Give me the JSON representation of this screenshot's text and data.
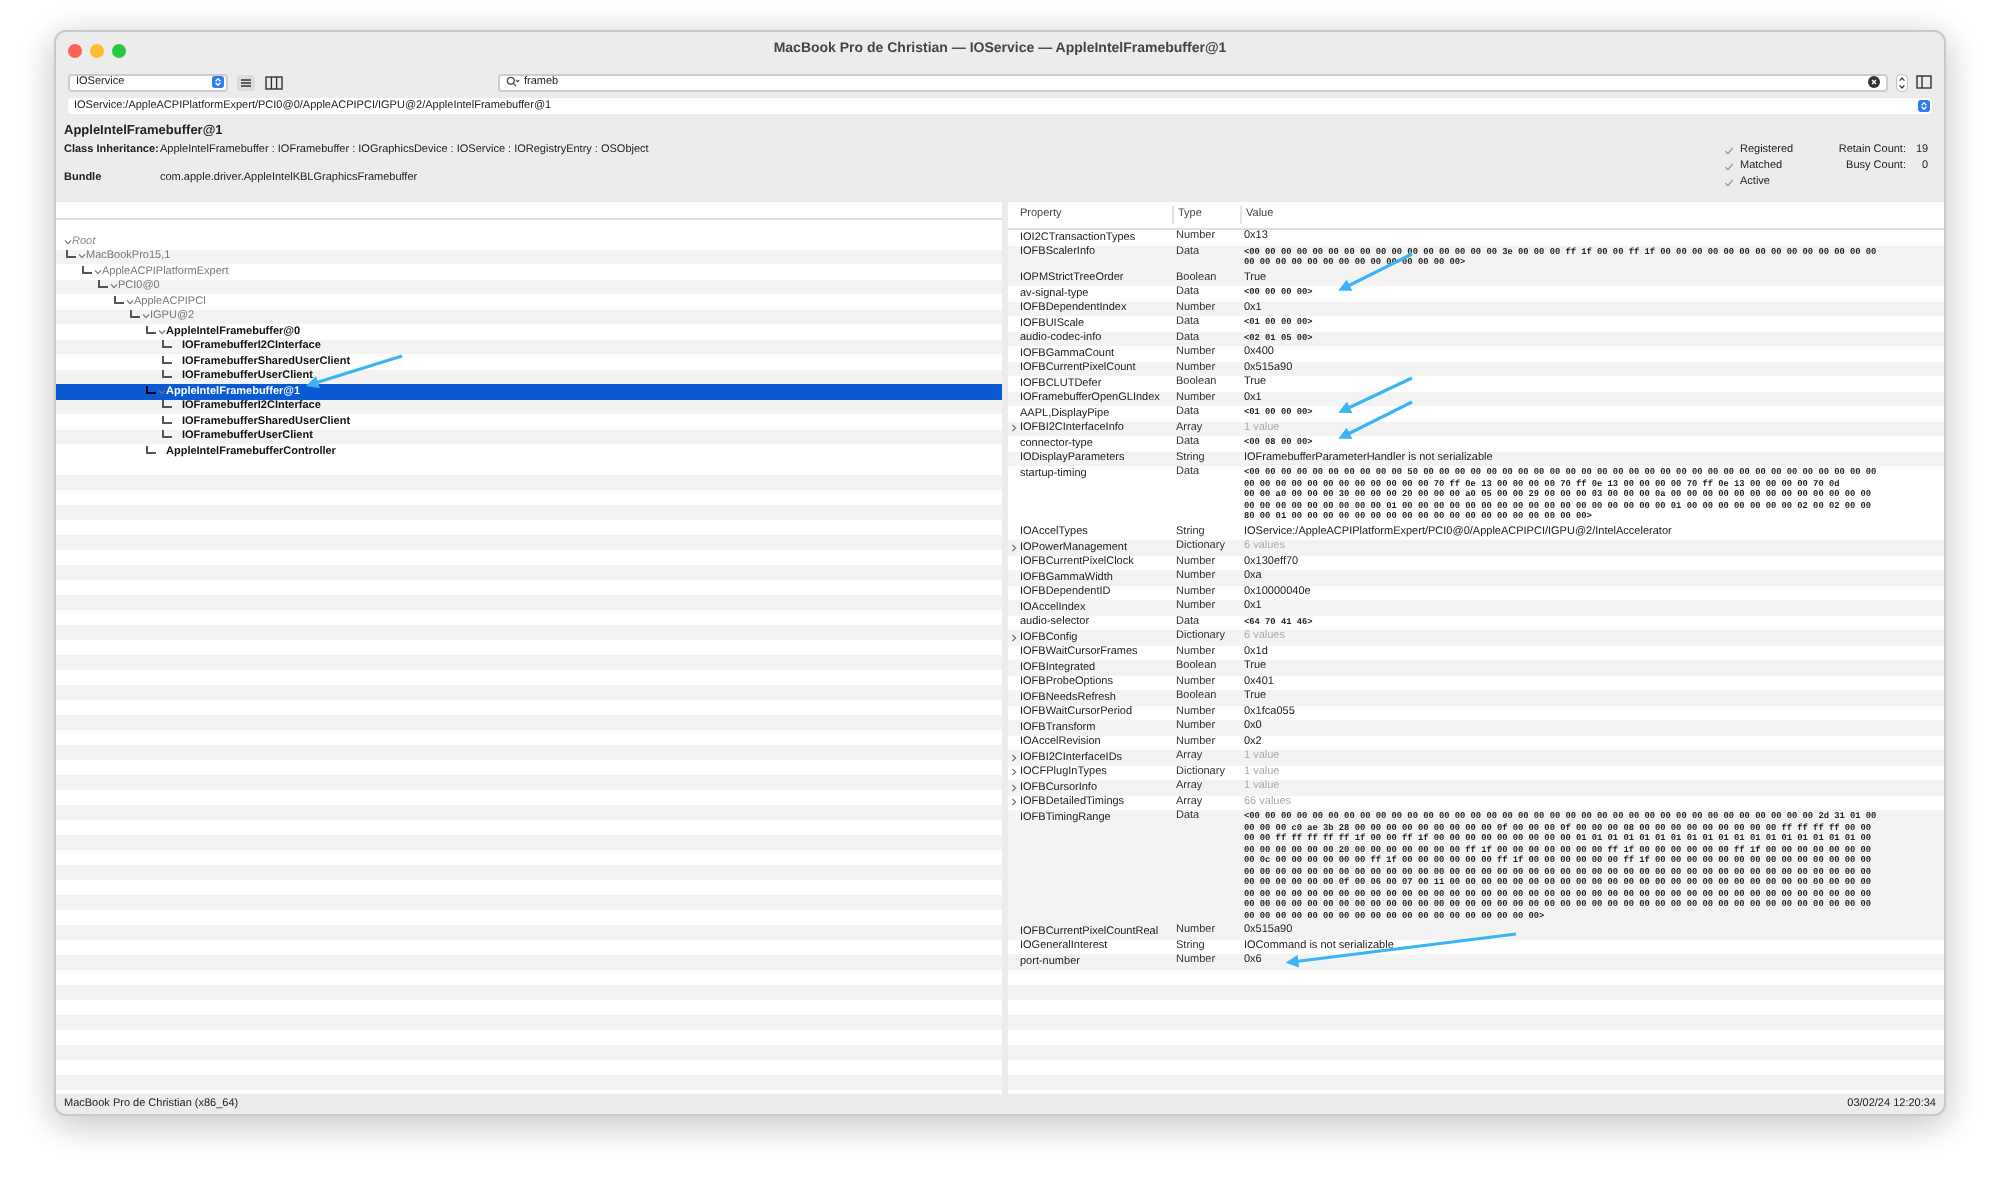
{
  "window": {
    "title": "MacBook Pro de Christian — IOService — AppleIntelFramebuffer@1"
  },
  "toolbar": {
    "plane": "IOService",
    "search": {
      "value": "frameb"
    }
  },
  "path": "IOService:/AppleACPIPlatformExpert/PCI0@0/AppleACPIPCI/IGPU@2/AppleIntelFramebuffer@1",
  "header": {
    "title": "AppleIntelFramebuffer@1",
    "inheritance_label": "Class Inheritance:",
    "inheritance": "AppleIntelFramebuffer : IOFramebuffer : IOGraphicsDevice : IOService : IORegistryEntry : OSObject",
    "bundle_label": "Bundle",
    "bundle": "com.apple.driver.AppleIntelKBLGraphicsFramebuffer",
    "flags": [
      {
        "label": "Registered",
        "checked": true
      },
      {
        "label": "Matched",
        "checked": true
      },
      {
        "label": "Active",
        "checked": true
      }
    ],
    "counts": [
      {
        "label": "Retain Count:",
        "value": "19"
      },
      {
        "label": "Busy Count:",
        "value": "0"
      }
    ]
  },
  "tree": [
    {
      "label": "Root",
      "kind": "root",
      "expanded": true,
      "selected": false,
      "children": [
        {
          "label": "MacBookPro15,1",
          "kind": "nub",
          "expanded": true,
          "selected": false,
          "children": [
            {
              "label": "AppleACPIPlatformExpert",
              "kind": "nub",
              "expanded": true,
              "selected": false,
              "children": [
                {
                  "label": "PCI0@0",
                  "kind": "nub",
                  "expanded": true,
                  "selected": false,
                  "children": [
                    {
                      "label": "AppleACPIPCI",
                      "kind": "nub",
                      "expanded": true,
                      "selected": false,
                      "children": [
                        {
                          "label": "IGPU@2",
                          "kind": "nub",
                          "expanded": true,
                          "selected": false,
                          "children": [
                            {
                              "label": "AppleIntelFramebuffer@0",
                              "kind": "service",
                              "expanded": true,
                              "selected": false,
                              "children": [
                                {
                                  "label": "IOFramebufferI2CInterface",
                                  "kind": "service",
                                  "selected": false
                                },
                                {
                                  "label": "IOFramebufferSharedUserClient",
                                  "kind": "service",
                                  "selected": false
                                },
                                {
                                  "label": "IOFramebufferUserClient",
                                  "kind": "service",
                                  "selected": false
                                }
                              ]
                            },
                            {
                              "label": "AppleIntelFramebuffer@1",
                              "kind": "service",
                              "expanded": true,
                              "selected": true,
                              "children": [
                                {
                                  "label": "IOFramebufferI2CInterface",
                                  "kind": "service",
                                  "selected": false
                                },
                                {
                                  "label": "IOFramebufferSharedUserClient",
                                  "kind": "service",
                                  "selected": false
                                },
                                {
                                  "label": "IOFramebufferUserClient",
                                  "kind": "service",
                                  "selected": false
                                }
                              ]
                            },
                            {
                              "label": "AppleIntelFramebufferController",
                              "kind": "service",
                              "selected": false
                            }
                          ]
                        }
                      ]
                    }
                  ]
                }
              ]
            }
          ]
        }
      ]
    }
  ],
  "table": {
    "columns": [
      "Property",
      "Type",
      "Value"
    ],
    "rows": [
      {
        "property": "IOI2CTransactionTypes",
        "type": "Number",
        "kind": "text",
        "value": [
          "0x13"
        ]
      },
      {
        "property": "IOFBScalerInfo",
        "type": "Data",
        "kind": "data",
        "value": [
          "<00 00 00 00 00 00 00 00 00 00 00 00 00 00 00 00 3e 00 00 00 ff 1f 00 00 ff 1f 00 00 00 00 00 00 00 00 00 00 00 00 00 00",
          "00 00 00 00 00 00 00 00 00 00 00 00 00 00>"
        ]
      },
      {
        "property": "IOPMStrictTreeOrder",
        "type": "Boolean",
        "kind": "text",
        "value": [
          "True"
        ]
      },
      {
        "property": "av-signal-type",
        "type": "Data",
        "kind": "data",
        "value": [
          "<00 00 00 00>"
        ]
      },
      {
        "property": "IOFBDependentIndex",
        "type": "Number",
        "kind": "text",
        "value": [
          "0x1"
        ]
      },
      {
        "property": "IOFBUIScale",
        "type": "Data",
        "kind": "data",
        "value": [
          "<01 00 00 00>"
        ]
      },
      {
        "property": "audio-codec-info",
        "type": "Data",
        "kind": "data",
        "value": [
          "<02 01 05 00>"
        ]
      },
      {
        "property": "IOFBGammaCount",
        "type": "Number",
        "kind": "text",
        "value": [
          "0x400"
        ]
      },
      {
        "property": "IOFBCurrentPixelCount",
        "type": "Number",
        "kind": "text",
        "value": [
          "0x515a90"
        ]
      },
      {
        "property": "IOFBCLUTDefer",
        "type": "Boolean",
        "kind": "text",
        "value": [
          "True"
        ]
      },
      {
        "property": "IOFramebufferOpenGLIndex",
        "type": "Number",
        "kind": "text",
        "value": [
          "0x1"
        ]
      },
      {
        "property": "AAPL,DisplayPipe",
        "type": "Data",
        "kind": "data",
        "value": [
          "<01 00 00 00>"
        ]
      },
      {
        "property": "IOFBI2CInterfaceInfo",
        "type": "Array",
        "kind": "count",
        "expanded": false,
        "value": [
          "1 value"
        ]
      },
      {
        "property": "connector-type",
        "type": "Data",
        "kind": "data",
        "value": [
          "<00 08 00 00>"
        ]
      },
      {
        "property": "IODisplayParameters",
        "type": "String",
        "kind": "text",
        "value": [
          "IOFramebufferParameterHandler is not serializable"
        ]
      },
      {
        "property": "startup-timing",
        "type": "Data",
        "kind": "data",
        "value": [
          "<00 00 00 00 00 00 00 00 00 00 50 00 00 00 00 00 00 00 00 00 00 00 00 00 00 00 00 00 00 00 00 00 00 00 00 00 00 00 00 00",
          "00 00 00 00 00 00 00 00 00 00 00 00 70 ff 0e 13 00 00 00 00 70 ff 0e 13 00 00 00 00 70 ff 0e 13 00 00 00 00 70 0d",
          "00 00 a0 00 00 00 30 00 00 00 20 00 00 00 a0 05 00 00 29 00 00 00 03 00 00 00 0a 00 00 00 00 00 00 00 00 00 00 00 00 00",
          "00 00 00 00 00 00 00 00 00 01 00 00 00 00 00 00 00 00 00 00 00 00 00 00 00 00 00 01 00 00 00 00 00 00 00 02 00 02 00 00",
          "80 00 01 00 00 00 00 00 00 00 00 00 00 00 00 00 00 00 00 00 00 00>"
        ]
      },
      {
        "property": "IOAccelTypes",
        "type": "String",
        "kind": "text",
        "value": [
          "IOService:/AppleACPIPlatformExpert/PCI0@0/AppleACPIPCI/IGPU@2/IntelAccelerator"
        ]
      },
      {
        "property": "IOPowerManagement",
        "type": "Dictionary",
        "kind": "count",
        "expanded": false,
        "value": [
          "6 values"
        ]
      },
      {
        "property": "IOFBCurrentPixelClock",
        "type": "Number",
        "kind": "text",
        "value": [
          "0x130eff70"
        ]
      },
      {
        "property": "IOFBGammaWidth",
        "type": "Number",
        "kind": "text",
        "value": [
          "0xa"
        ]
      },
      {
        "property": "IOFBDependentID",
        "type": "Number",
        "kind": "text",
        "value": [
          "0x10000040e"
        ]
      },
      {
        "property": "IOAccelIndex",
        "type": "Number",
        "kind": "text",
        "value": [
          "0x1"
        ]
      },
      {
        "property": "audio-selector",
        "type": "Data",
        "kind": "data",
        "value": [
          "<64 70 41 46>"
        ]
      },
      {
        "property": "IOFBConfig",
        "type": "Dictionary",
        "kind": "count",
        "expanded": false,
        "value": [
          "6 values"
        ]
      },
      {
        "property": "IOFBWaitCursorFrames",
        "type": "Number",
        "kind": "text",
        "value": [
          "0x1d"
        ]
      },
      {
        "property": "IOFBIntegrated",
        "type": "Boolean",
        "kind": "text",
        "value": [
          "True"
        ]
      },
      {
        "property": "IOFBProbeOptions",
        "type": "Number",
        "kind": "text",
        "value": [
          "0x401"
        ]
      },
      {
        "property": "IOFBNeedsRefresh",
        "type": "Boolean",
        "kind": "text",
        "value": [
          "True"
        ]
      },
      {
        "property": "IOFBWaitCursorPeriod",
        "type": "Number",
        "kind": "text",
        "value": [
          "0x1fca055"
        ]
      },
      {
        "property": "IOFBTransform",
        "type": "Number",
        "kind": "text",
        "value": [
          "0x0"
        ]
      },
      {
        "property": "IOAccelRevision",
        "type": "Number",
        "kind": "text",
        "value": [
          "0x2"
        ]
      },
      {
        "property": "IOFBI2CInterfaceIDs",
        "type": "Array",
        "kind": "count",
        "expanded": false,
        "value": [
          "1 value"
        ]
      },
      {
        "property": "IOCFPlugInTypes",
        "type": "Dictionary",
        "kind": "count",
        "expanded": false,
        "value": [
          "1 value"
        ]
      },
      {
        "property": "IOFBCursorInfo",
        "type": "Array",
        "kind": "count",
        "expanded": false,
        "value": [
          "1 value"
        ]
      },
      {
        "property": "IOFBDetailedTimings",
        "type": "Array",
        "kind": "count",
        "expanded": false,
        "value": [
          "66 values"
        ]
      },
      {
        "property": "IOFBTimingRange",
        "type": "Data",
        "kind": "data",
        "value": [
          "<00 00 00 00 00 00 00 00 00 00 00 00 00 00 00 00 00 00 00 00 00 00 00 00 00 00 00 00 00 00 00 00 00 00 00 00 2d 31 01 00",
          "00 00 00 c0 ae 3b 28 00 00 00 00 00 00 00 00 00 0f 00 00 00 0f 00 00 00 08 00 00 00 00 00 00 00 00 00 ff ff ff ff 00 00",
          "00 00 ff ff ff ff ff 1f 00 00 ff 1f 00 00 00 00 00 00 00 00 00 01 01 01 01 01 01 01 01 01 01 01 01 01 01 01 01 01 01 00",
          "00 00 00 00 00 00 20 00 00 00 00 00 00 00 ff 1f 00 00 00 00 00 00 00 ff 1f 00 00 00 00 00 00 ff 1f 00 00 00 00 00 00 00",
          "00 0c 00 00 00 00 00 00 ff 1f 00 00 00 00 00 00 ff 1f 00 00 00 00 00 00 ff 1f 00 00 00 00 00 00 00 00 00 00 00 00 00 00",
          "00 00 00 00 00 00 00 00 00 00 00 00 00 00 00 00 00 00 00 00 00 00 00 00 00 00 00 00 00 00 00 00 00 00 00 00 00 00 00 00",
          "00 00 00 00 00 00 0f 00 06 00 07 00 11 00 00 00 00 00 00 00 00 00 00 00 00 00 00 00 00 00 00 00 00 00 00 00 00 00 00 00",
          "00 00 00 00 00 00 00 00 00 00 00 00 00 00 00 00 00 00 00 00 00 00 00 00 00 00 00 00 00 00 00 00 00 00 00 00 00 00 00 00",
          "00 00 00 00 00 00 00 00 00 00 00 00 00 00 00 00 00 00 00 00 00 00 00 00 00 00 00 00 00 00 00 00 00 00 00 00 00 00 00 00",
          "00 00 00 00 00 00 00 00 00 00 00 00 00 00 00 00 00 00 00>"
        ]
      },
      {
        "property": "IOFBCurrentPixelCountReal",
        "type": "Number",
        "kind": "text",
        "value": [
          "0x515a90"
        ]
      },
      {
        "property": "IOGeneralInterest",
        "type": "String",
        "kind": "text",
        "value": [
          "IOCommand is not serializable"
        ]
      },
      {
        "property": "port-number",
        "type": "Number",
        "kind": "text",
        "value": [
          "0x6"
        ]
      }
    ]
  },
  "status_bar": {
    "left": "MacBook Pro de Christian (x86_64)",
    "right": "03/02/24 12:20:34"
  }
}
